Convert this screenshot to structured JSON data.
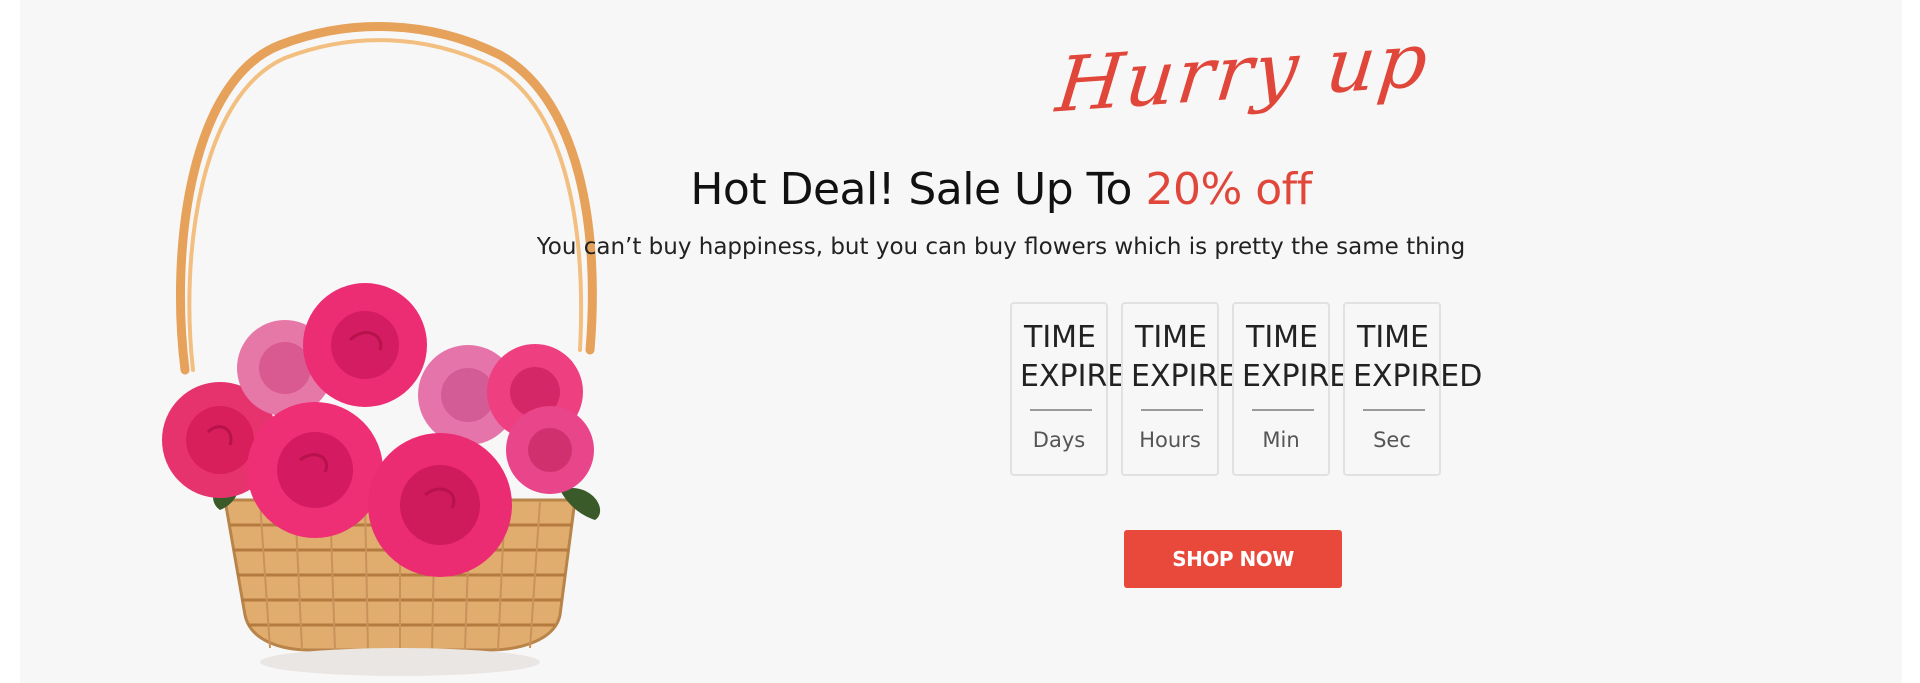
{
  "promo": {
    "script_title": "Hurry up",
    "headline_prefix": "Hot Deal! Sale Up To ",
    "headline_accent": "20% off",
    "subline": "You can’t buy happiness, but you can buy flowers which is pretty the same thing"
  },
  "countdown": [
    {
      "value_line1": "TIME",
      "value_line2": "EXPIRED",
      "label": "Days"
    },
    {
      "value_line1": "TIME",
      "value_line2": "EXPIRED",
      "label": "Hours"
    },
    {
      "value_line1": "TIME",
      "value_line2": "EXPIRED",
      "label": "Min"
    },
    {
      "value_line1": "TIME",
      "value_line2": "EXPIRED",
      "label": "Sec"
    }
  ],
  "cta": {
    "label": "SHOP NOW"
  },
  "colors": {
    "accent": "#e0463a",
    "button": "#e8493a",
    "background": "#f8f7f7"
  },
  "image": {
    "icon": "flower-basket-image"
  }
}
